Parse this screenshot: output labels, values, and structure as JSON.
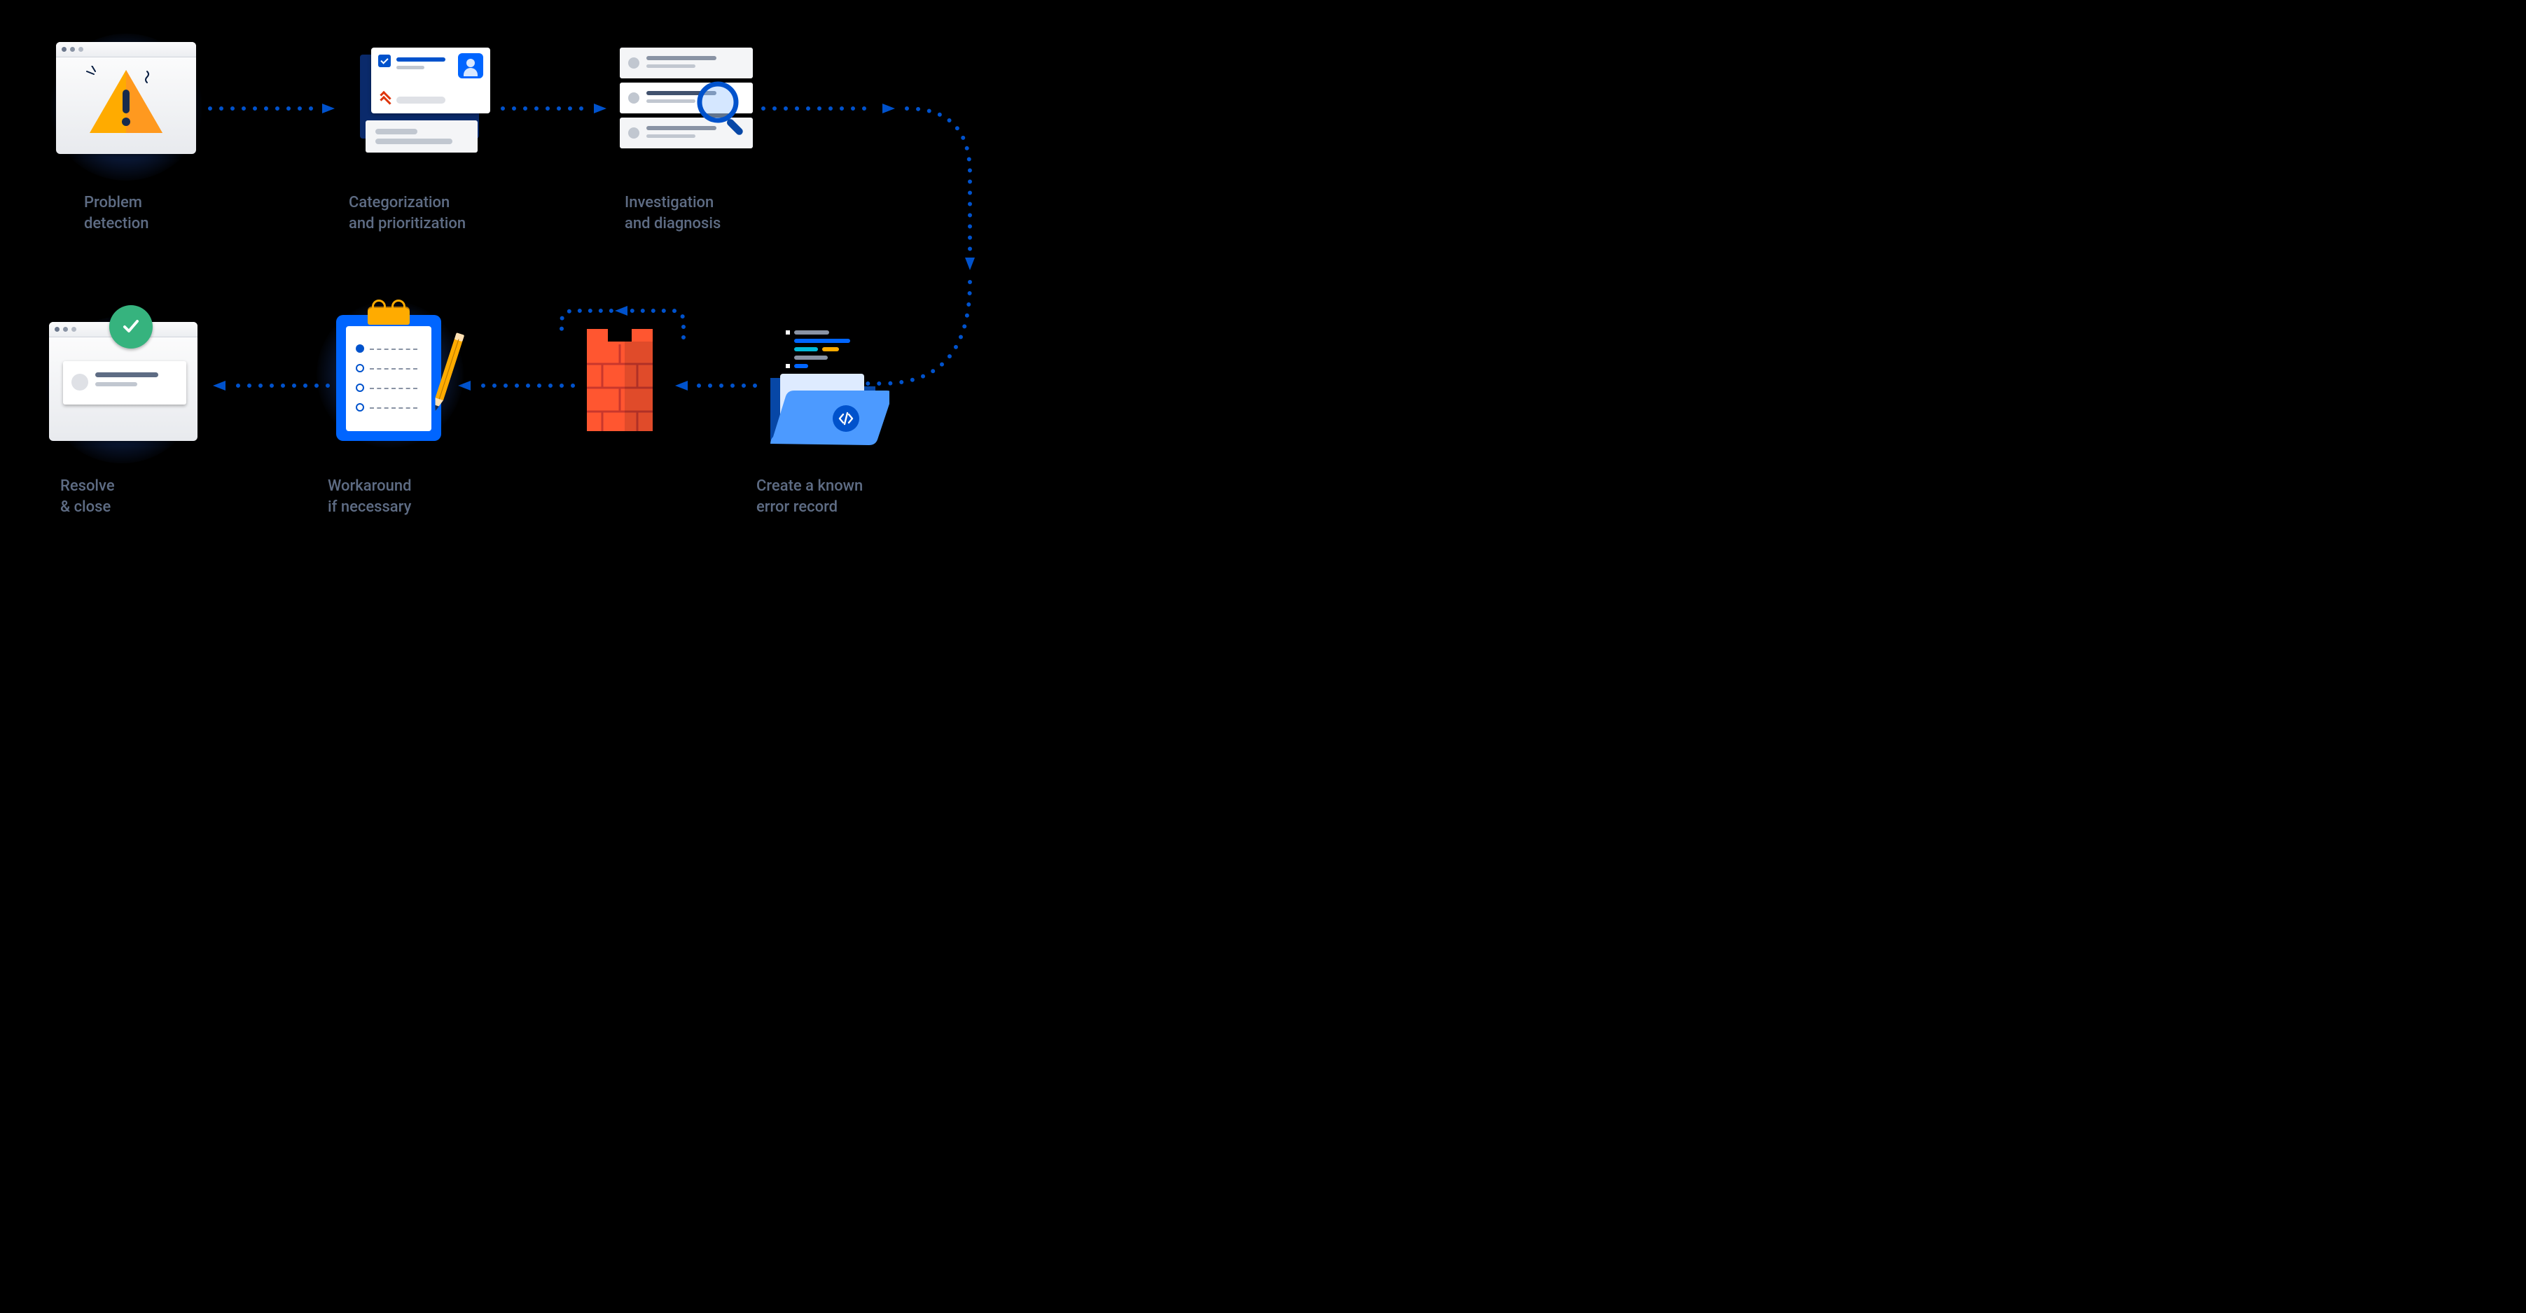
{
  "steps": {
    "detection": {
      "label": "Problem\ndetection"
    },
    "categorize": {
      "label": "Categorization\nand prioritization"
    },
    "investigate": {
      "label": "Investigation\nand diagnosis"
    },
    "known_error": {
      "label": "Create a known\nerror record"
    },
    "workaround": {
      "label": "Workaround\nif necessary"
    },
    "resolve": {
      "label": "Resolve\n& close"
    }
  },
  "connector_color": "#0052cc"
}
